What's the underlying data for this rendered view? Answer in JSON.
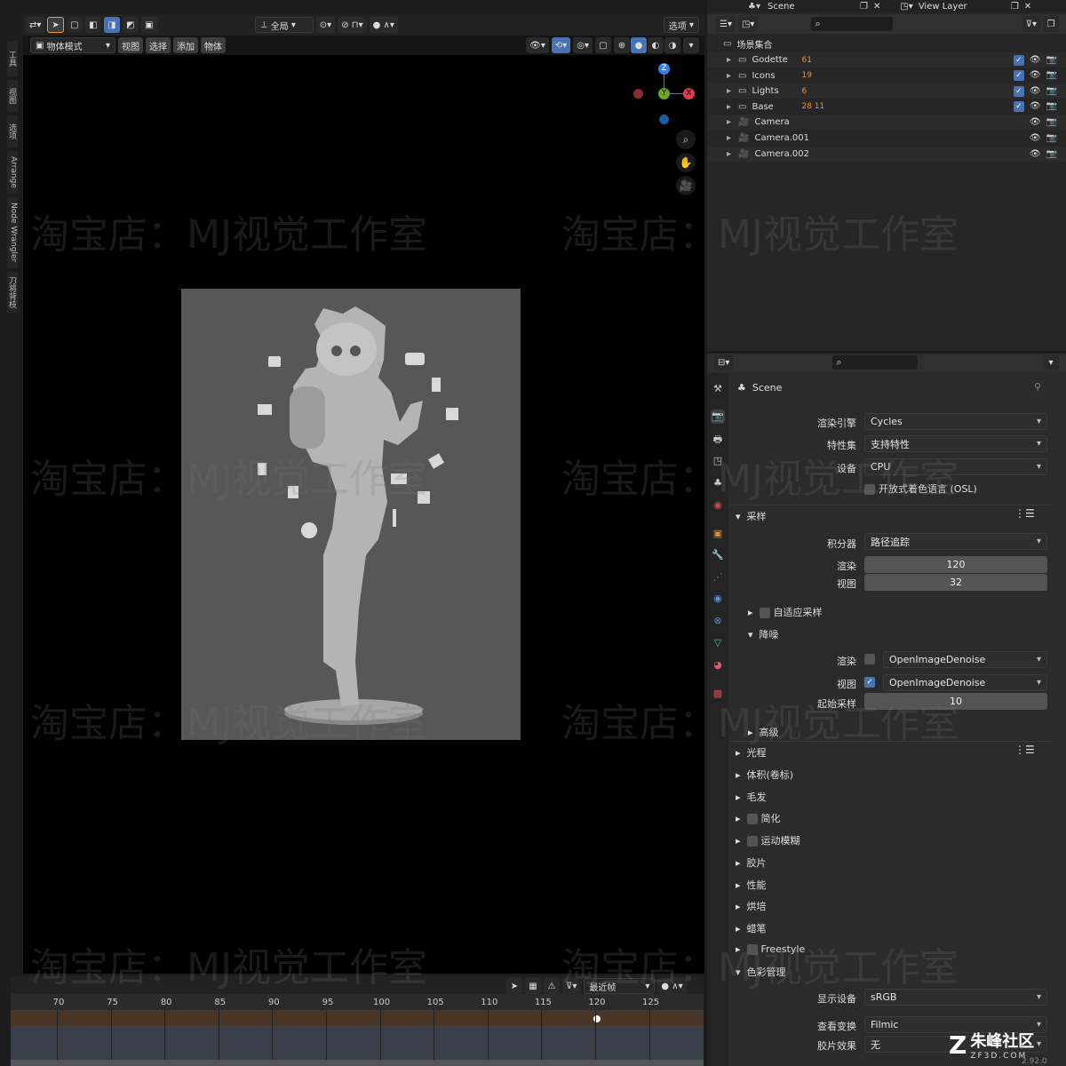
{
  "viewport": {
    "mode": "物体模式",
    "menus": [
      "视图",
      "选择",
      "添加",
      "物体"
    ],
    "transform": "全局",
    "options": "选项",
    "side_tabs": [
      "工具",
      "视图",
      "选项",
      "Arrange",
      "Node Wrangler",
      "刀将背枝"
    ],
    "gizmo": {
      "z": "Z",
      "y": "Y",
      "x": "X"
    }
  },
  "outliner": {
    "scene": "Scene",
    "view_layer": "View Layer",
    "root": "场景集合",
    "rows": [
      {
        "name": "Godette",
        "badge": "61"
      },
      {
        "name": "Icons",
        "badge": "19"
      },
      {
        "name": "Lights",
        "badge": "6"
      },
      {
        "name": "Base",
        "badge": "28  11"
      },
      {
        "name": "Camera",
        "badge": ""
      },
      {
        "name": "Camera.001",
        "badge": ""
      },
      {
        "name": "Camera.002",
        "badge": ""
      }
    ]
  },
  "properties": {
    "title": "Scene",
    "render_engine_label": "渲染引擎",
    "render_engine": "Cycles",
    "feature_label": "特性集",
    "feature": "支持特性",
    "device_label": "设备",
    "device": "CPU",
    "osl": "开放式着色语言 (OSL)",
    "sampling": "采样",
    "integrator_label": "积分器",
    "integrator": "路径追踪",
    "render_label": "渲染",
    "render_samples": "120",
    "viewport_label": "视图",
    "viewport_samples": "32",
    "adaptive": "自适应采样",
    "denoise": "降噪",
    "denoise_render_label": "渲染",
    "denoise_render": "OpenImageDenoise",
    "denoise_view_label": "视图",
    "denoise_view": "OpenImageDenoise",
    "start_sample_label": "起始采样",
    "start_sample": "10",
    "advanced": "高级",
    "light_paths": "光程",
    "volumes": "体积(卷标)",
    "hair": "毛发",
    "simplify": "简化",
    "motion_blur": "运动模糊",
    "film": "胶片",
    "performance": "性能",
    "bake": "烘培",
    "grease_pencil": "蜡笔",
    "freestyle": "Freestyle",
    "color_management": "色彩管理",
    "display_device_label": "显示设备",
    "display_device": "sRGB",
    "view_transform_label": "查看变换",
    "view_transform": "Filmic",
    "look_label": "胶片效果",
    "look": "无"
  },
  "timeline": {
    "ticks": [
      "70",
      "75",
      "80",
      "85",
      "90",
      "95",
      "100",
      "105",
      "110",
      "115",
      "120",
      "125"
    ],
    "interp": "最近帧",
    "version": "2.92.0"
  },
  "watermark": {
    "text": "淘宝店：MJ视觉工作室",
    "logo": "朱峰社区",
    "logo_sub": "ZF3D.COM"
  }
}
